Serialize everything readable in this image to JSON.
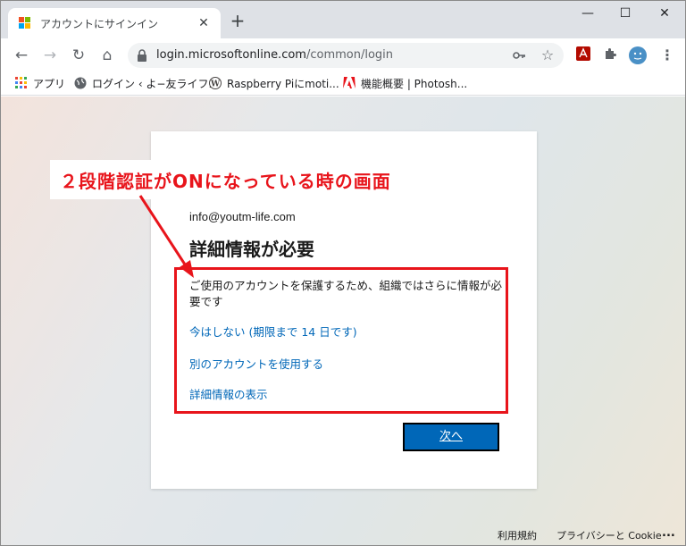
{
  "browser": {
    "tab_title": "アカウントにサインイン",
    "tab_close": "✕",
    "new_tab": "+",
    "url_host": "login.microsoftonline.com",
    "url_path": "/common/login",
    "controls": {
      "minimize": "—",
      "maximize": "☐",
      "close": "✕"
    },
    "nav": {
      "back": "←",
      "forward": "→",
      "reload": "↻",
      "home": "⌂"
    },
    "menu_glyph": "⋮"
  },
  "bookmarks": [
    {
      "label": "アプリ",
      "icon": "apps-grid-icon"
    },
    {
      "label": "ログイン ‹ よ−友ライフ...",
      "icon": "globe-icon"
    },
    {
      "label": "Raspberry Piにmoti...",
      "icon": "wordpress-icon"
    },
    {
      "label": "機能概要 | Photosh...",
      "icon": "adobe-icon"
    }
  ],
  "signin": {
    "email": "info@youtm-life.com",
    "heading": "詳細情報が必要",
    "description": "ご使用のアカウントを保護するため、組織ではさらに情報が必要です",
    "links": [
      "今はしない (期限まで 14 日です)",
      "別のアカウントを使用する",
      "詳細情報の表示"
    ],
    "next_button": "次へ"
  },
  "annotation": {
    "label": "２段階認証がONになっている時の画面",
    "color": "#e8141b"
  },
  "footer": {
    "terms": "利用規約",
    "privacy": "プライバシーと Cookie",
    "more": "..."
  },
  "colors": {
    "accent_blue": "#0067b8",
    "tab_strip": "#dee1e6"
  }
}
